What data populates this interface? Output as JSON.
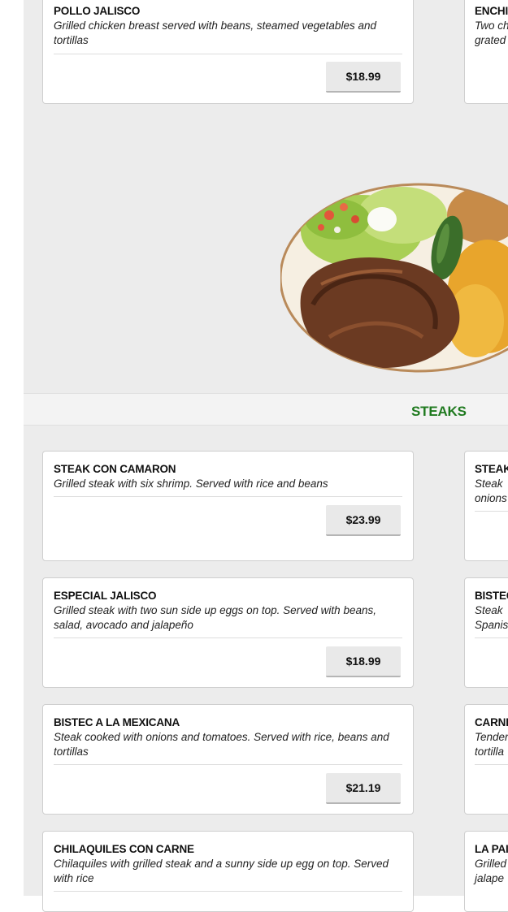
{
  "top_section": {
    "left_card": {
      "title": "POLLO JALISCO",
      "description": "Grilled chicken breast served with beans, steamed vegetables and tortillas",
      "price": "$18.99"
    },
    "right_card_partial": {
      "title": "ENCHI",
      "description": "Two ch grated"
    }
  },
  "food_photo": {
    "alt": "Grilled steak plate with salad, rice and jalapeño"
  },
  "section": {
    "title": "STEAKS"
  },
  "steaks": {
    "left": [
      {
        "title": "STEAK CON CAMARON",
        "description": "Grilled steak with six shrimp. Served with rice and beans",
        "price": "$23.99"
      },
      {
        "title": "ESPECIAL JALISCO",
        "description": "Grilled steak with two sun side up eggs on top. Served with beans, salad, avocado and jalapeño",
        "price": "$18.99"
      },
      {
        "title": "BISTEC A LA MEXICANA",
        "description": "Steak cooked with onions and tomatoes. Served with rice, beans and tortillas",
        "price": "$21.19"
      },
      {
        "title": "CHILAQUILES CON CARNE",
        "description": "Chilaquiles with grilled steak and a sunny side up egg on top. Served with rice"
      }
    ],
    "right_partial": [
      {
        "title": "STEAK",
        "description": "Steak onions"
      },
      {
        "title": "BISTEC",
        "description": "Steak Spanis"
      },
      {
        "title": "CARNI",
        "description": "Tender tortilla"
      },
      {
        "title": "LA PAI",
        "description": "Grilled jalape"
      }
    ]
  },
  "colors": {
    "page_background": "#ececec",
    "card_background": "#ffffff",
    "section_title": "#1f7a1f",
    "price_button": "#e9e9e9"
  }
}
